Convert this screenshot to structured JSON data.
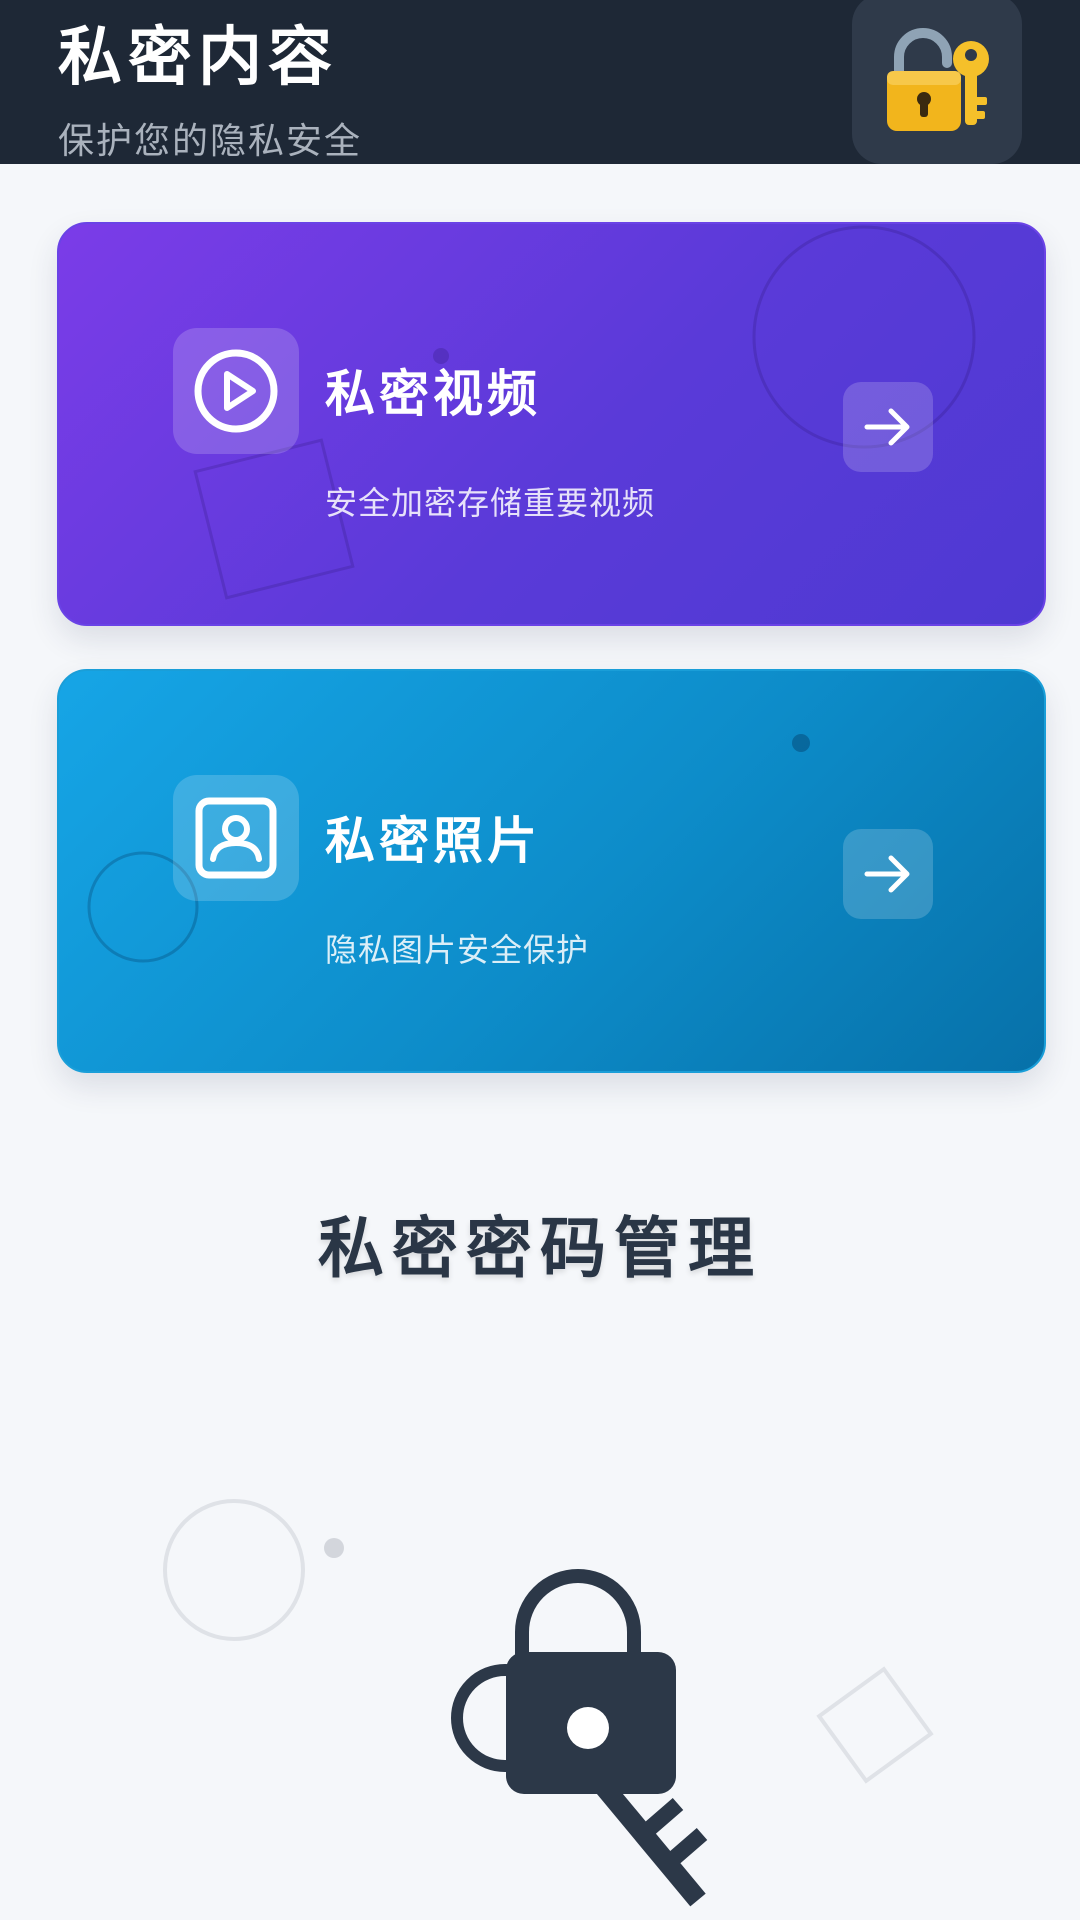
{
  "header": {
    "title": "私密内容",
    "subtitle": "保护您的隐私安全",
    "badge_icon": "lock-with-key-emoji"
  },
  "cards": [
    {
      "title": "私密视频",
      "description": "安全加密存储重要视频",
      "icon": "play-circle-icon",
      "action_icon": "arrow-right-icon",
      "color": "#6a3de0"
    },
    {
      "title": "私密照片",
      "description": "隐私图片安全保护",
      "icon": "user-photo-icon",
      "action_icon": "arrow-right-icon",
      "color": "#0f8fcc"
    }
  ],
  "section": {
    "title": "私密密码管理",
    "illustration_icon": "lock-key-icon"
  },
  "colors": {
    "header_bg": "#1e2836",
    "page_bg": "#f5f7fa",
    "text_dark": "#2a3646"
  }
}
